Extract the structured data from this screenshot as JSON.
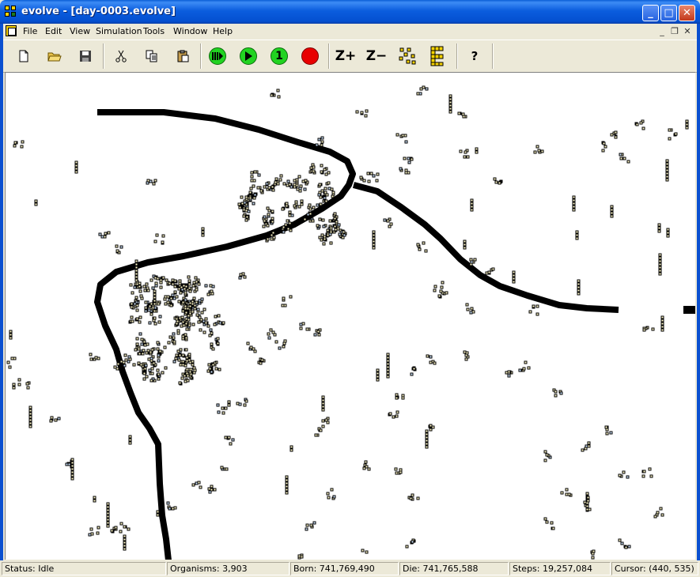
{
  "window": {
    "title": "evolve - [day-0003.evolve]"
  },
  "window_controls": {
    "minimize": "_",
    "maximize": "□",
    "close": "✕"
  },
  "menu": [
    "File",
    "Edit",
    "View",
    "Simulation",
    "Tools",
    "Window",
    "Help"
  ],
  "mdi_controls": {
    "minimize": "_",
    "restore": "❐",
    "close": "✕"
  },
  "toolbar": {
    "step_label": "1",
    "zoom_in": "Z+",
    "zoom_out": "Z−",
    "help_glyph": "?",
    "icons": [
      "new-file-icon",
      "open-folder-icon",
      "save-disk-icon",
      "cut-scissors-icon",
      "copy-icon",
      "paste-icon",
      "run-fast-icon",
      "run-icon",
      "step-icon",
      "stop-icon",
      "zoom-in-icon",
      "zoom-out-icon",
      "scatter-view-icon",
      "organism-grid-icon",
      "help-icon"
    ],
    "colors": {
      "green": "#21d321",
      "red": "#e80000",
      "yellow": "#f5d200"
    }
  },
  "status": {
    "state": "Status: Idle",
    "organisms": "Organisms: 3,903",
    "born": "Born: 741,769,490",
    "die": "Die: 741,765,588",
    "steps": "Steps: 19,257,084",
    "cursor": "Cursor: (440, 535)"
  },
  "world": {
    "colors": {
      "barrier": "#000000",
      "organism_fill": "#fff9c8",
      "organism_alt": "#cfe6ff",
      "background": "#ffffff"
    }
  }
}
